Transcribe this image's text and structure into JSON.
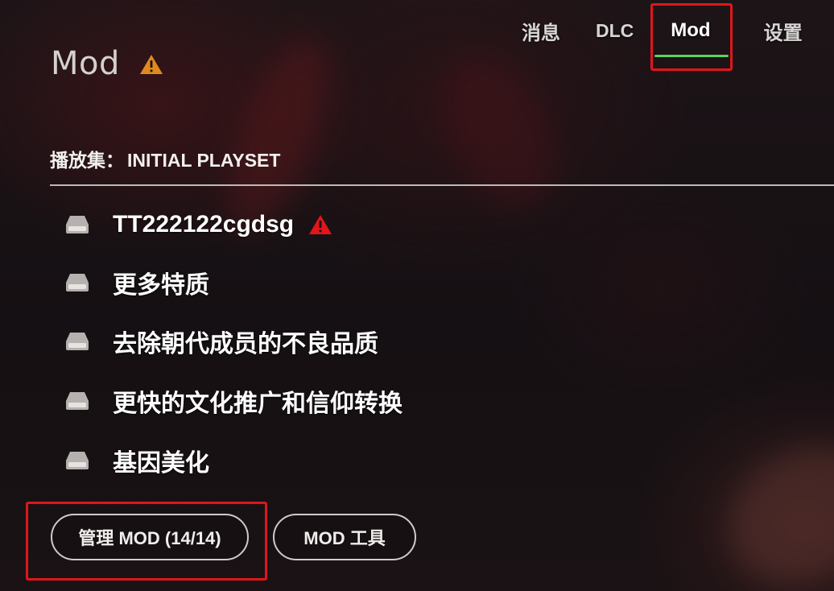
{
  "nav": {
    "tabs": [
      {
        "label": "消息"
      },
      {
        "label": "DLC"
      },
      {
        "label": "Mod",
        "active": true
      },
      {
        "label": "设置"
      }
    ],
    "active_underline_color": "#58d45a"
  },
  "page": {
    "title": "Mod",
    "title_icon": "warning-triangle-icon",
    "title_icon_color": "#e08a1c"
  },
  "playset": {
    "label": "播放集：",
    "value": "INITIAL PLAYSET"
  },
  "mods": [
    {
      "name": "TT222122cgdsg",
      "icon": "drive-icon",
      "warning": true,
      "warning_color": "#e0161a"
    },
    {
      "name": "更多特质",
      "icon": "drive-icon"
    },
    {
      "name": "去除朝代成员的不良品质",
      "icon": "drive-icon"
    },
    {
      "name": "更快的文化推广和信仰转换",
      "icon": "drive-icon"
    },
    {
      "name": "基因美化",
      "icon": "drive-icon"
    }
  ],
  "buttons": {
    "manage_label": "管理 MOD (14/14)",
    "tools_label": "MOD 工具"
  },
  "annotation_color": "#e0161a"
}
